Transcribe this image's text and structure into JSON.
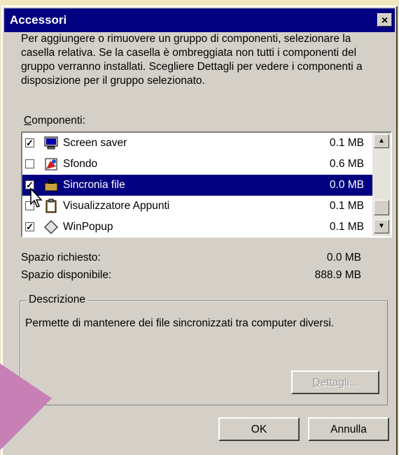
{
  "window": {
    "title": "Accessori",
    "close_glyph": "×"
  },
  "description": "Per aggiungere o rimuovere un gruppo di componenti, selezionare la casella relativa. Se la casella è ombreggiata non tutti i componenti del gruppo verranno installati. Scegliere Dettagli per vedere i componenti a disposizione per il gruppo selezionato.",
  "components": {
    "label_first": "C",
    "label_rest": "omponenti:",
    "items": [
      {
        "name": "Screen saver",
        "size": "0.1 MB",
        "checked": true,
        "icon": "monitor-icon"
      },
      {
        "name": "Sfondo",
        "size": "0.6 MB",
        "checked": false,
        "icon": "wallpaper-icon"
      },
      {
        "name": "Sincronia file",
        "size": "0.0 MB",
        "checked": true,
        "selected": true,
        "icon": "briefcase-icon"
      },
      {
        "name": "Visualizzatore Appunti",
        "size": "0.1 MB",
        "checked": false,
        "icon": "clipboard-icon"
      },
      {
        "name": "WinPopup",
        "size": "0.1 MB",
        "checked": true,
        "icon": "diamond-icon"
      }
    ],
    "check_glyph": "✓"
  },
  "space": {
    "required_label": "Spazio richiesto:",
    "required_value": "0.0 MB",
    "available_label": "Spazio disponibile:",
    "available_value": "888.9 MB"
  },
  "group": {
    "label": "Descrizione",
    "text": "Permette di mantenere dei file sincronizzati tra computer diversi."
  },
  "buttons": {
    "details_first": "D",
    "details_rest": "ettagli...",
    "ok": "OK",
    "cancel": "Annulla"
  },
  "scroll": {
    "up": "▲",
    "down": "▼"
  },
  "colors": {
    "titlebar": "#000080",
    "background": "#f3e7c2",
    "face": "#d4d0c8",
    "arrow": "#c77fb6"
  }
}
